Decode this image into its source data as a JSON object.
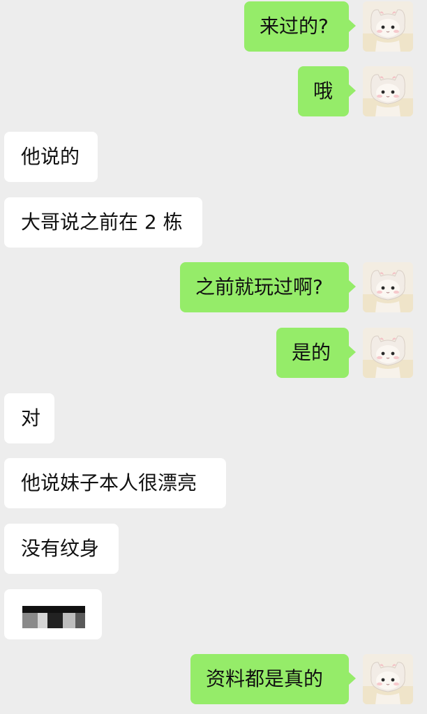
{
  "messages": [
    {
      "side": "out",
      "text": "来过的?"
    },
    {
      "side": "out",
      "text": "哦"
    },
    {
      "side": "in",
      "text": "他说的"
    },
    {
      "side": "in",
      "text": "大哥说之前在 2 栋"
    },
    {
      "side": "out",
      "text": "之前就玩过啊?"
    },
    {
      "side": "out",
      "text": "是的"
    },
    {
      "side": "in",
      "text": "对"
    },
    {
      "side": "in",
      "text": "他说妹子本人很漂亮"
    },
    {
      "side": "in",
      "text": "没有纹身"
    },
    {
      "side": "in",
      "text": "",
      "redacted": true
    },
    {
      "side": "out",
      "text": "资料都是真的"
    }
  ],
  "colors": {
    "background": "#ededed",
    "outgoing_bubble": "#95ec69",
    "incoming_bubble": "#ffffff"
  },
  "icons": {
    "user_avatar": "cat-hat-doll-avatar-icon"
  }
}
